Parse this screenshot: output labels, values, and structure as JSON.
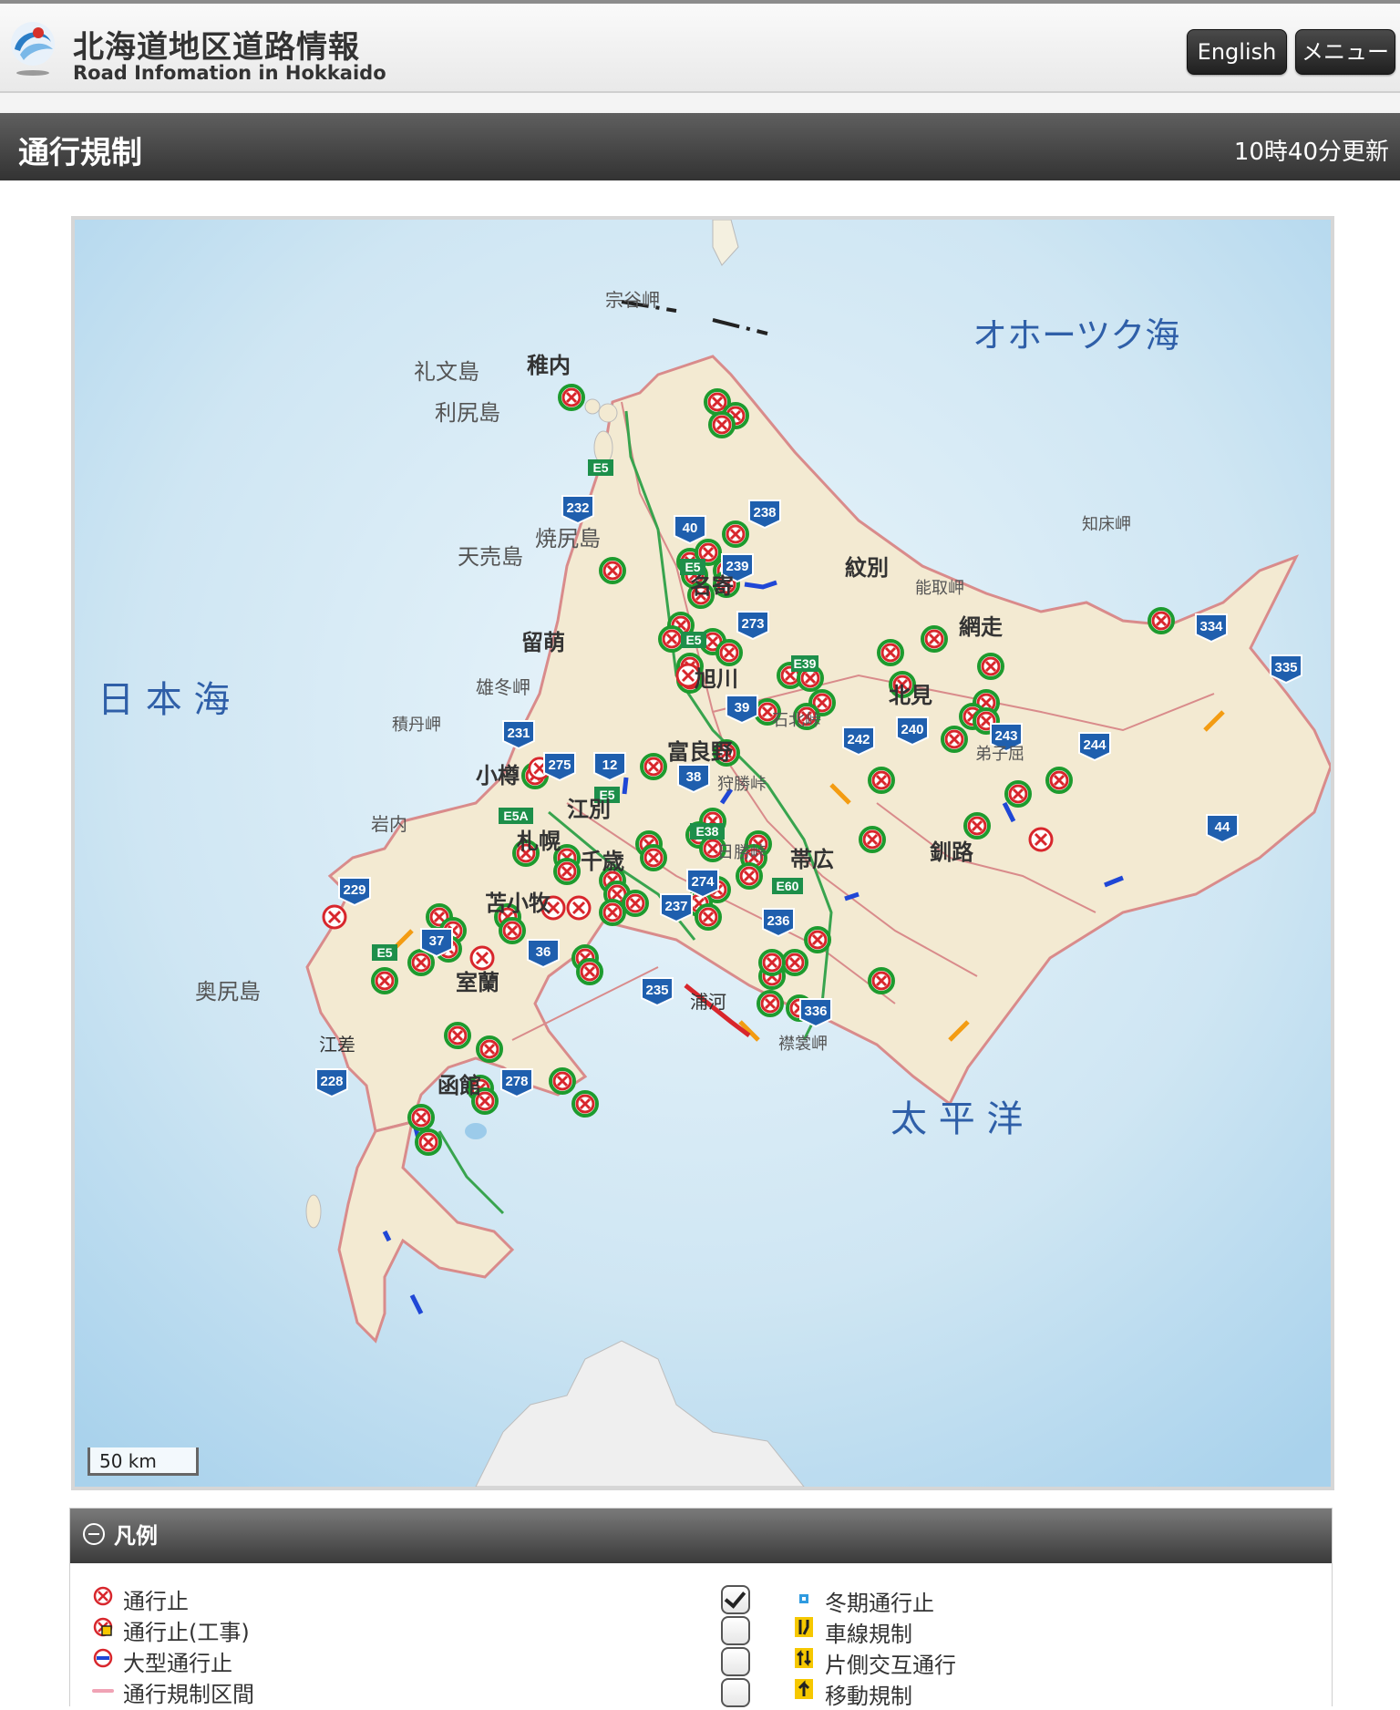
{
  "header": {
    "title": "北海道地区道路情報",
    "subtitle": "Road Infomation in Hokkaido",
    "english_button": "English",
    "menu_button": "メニュー"
  },
  "titlebar": {
    "title": "通行規制",
    "updated": "10時40分更新"
  },
  "map": {
    "scale_label": "50 km",
    "seas": {
      "japan_sea": "日 本 海",
      "okhotsk": "オホーツク海",
      "pacific": "太 平 洋"
    },
    "places": [
      {
        "name": "稚内",
        "type": "city"
      },
      {
        "name": "礼文島",
        "type": "island"
      },
      {
        "name": "利尻島",
        "type": "island"
      },
      {
        "name": "天売島",
        "type": "island"
      },
      {
        "name": "焼尻島",
        "type": "island"
      },
      {
        "name": "宗谷岬",
        "type": "cape"
      },
      {
        "name": "紋別",
        "type": "city"
      },
      {
        "name": "名寄",
        "type": "city"
      },
      {
        "name": "留萌",
        "type": "city"
      },
      {
        "name": "雄冬岬",
        "type": "cape"
      },
      {
        "name": "網走",
        "type": "city"
      },
      {
        "name": "能取岬",
        "type": "cape"
      },
      {
        "name": "知床岬",
        "type": "cape"
      },
      {
        "name": "北見",
        "type": "city"
      },
      {
        "name": "旭川",
        "type": "city"
      },
      {
        "name": "石北峠",
        "type": "pass"
      },
      {
        "name": "積丹岬",
        "type": "cape"
      },
      {
        "name": "小樽",
        "type": "city"
      },
      {
        "name": "江別",
        "type": "city"
      },
      {
        "name": "富良野",
        "type": "city"
      },
      {
        "name": "狩勝峠",
        "type": "pass"
      },
      {
        "name": "弟子屈",
        "type": "city"
      },
      {
        "name": "岩内",
        "type": "city"
      },
      {
        "name": "札幌",
        "type": "city"
      },
      {
        "name": "千歳",
        "type": "city"
      },
      {
        "name": "日勝峠",
        "type": "pass"
      },
      {
        "name": "帯広",
        "type": "city"
      },
      {
        "name": "釧路",
        "type": "city"
      },
      {
        "name": "苫小牧",
        "type": "city"
      },
      {
        "name": "室蘭",
        "type": "city"
      },
      {
        "name": "奥尻島",
        "type": "island"
      },
      {
        "name": "浦河",
        "type": "city"
      },
      {
        "name": "襟裳岬",
        "type": "cape"
      },
      {
        "name": "江差",
        "type": "city"
      },
      {
        "name": "函館",
        "type": "city"
      }
    ],
    "route_shields": [
      "232",
      "40",
      "238",
      "239",
      "273",
      "334",
      "335",
      "39",
      "240",
      "243",
      "244",
      "231",
      "275",
      "12",
      "38",
      "44",
      "229",
      "37",
      "36",
      "274",
      "237",
      "236",
      "235",
      "336",
      "228",
      "278",
      "242"
    ],
    "expressway_shields": [
      "E5",
      "E5",
      "E5",
      "E39",
      "E5",
      "E5A",
      "E38",
      "E60",
      "E5"
    ]
  },
  "legend": {
    "heading": "凡例",
    "items_left": [
      {
        "label": "通行止",
        "icon": "closed-icon"
      },
      {
        "label": "通行止(工事)",
        "icon": "closed-construction-icon"
      },
      {
        "label": "大型通行止",
        "icon": "large-vehicle-closed-icon"
      },
      {
        "label": "通行規制区間",
        "icon": "restricted-section-line"
      }
    ],
    "items_right": [
      {
        "label": "冬期通行止",
        "icon": "winter-closed-icon",
        "checked": true
      },
      {
        "label": "車線規制",
        "icon": "lane-restriction-icon",
        "checked": false
      },
      {
        "label": "片側交互通行",
        "icon": "alternating-traffic-icon",
        "checked": false
      },
      {
        "label": "移動規制",
        "icon": "mobile-restriction-icon",
        "checked": false
      }
    ]
  }
}
